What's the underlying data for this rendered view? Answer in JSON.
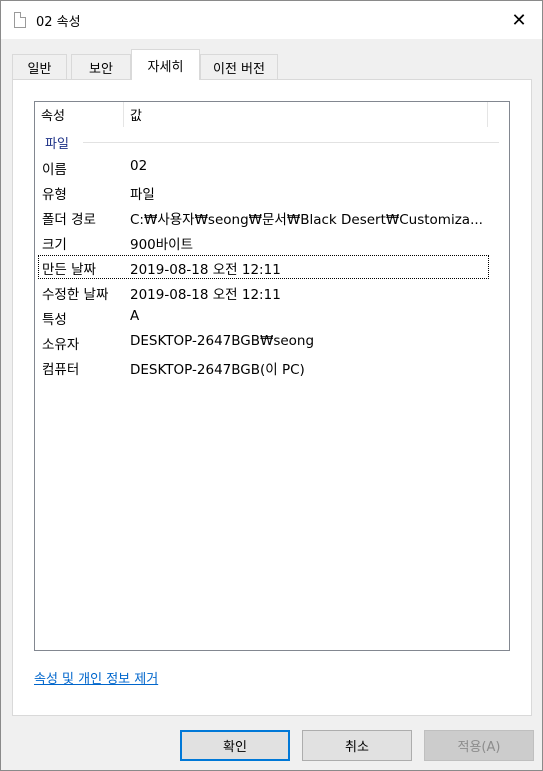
{
  "window": {
    "title": "02 속성",
    "close_label": "✕"
  },
  "tabs": [
    {
      "label": "일반"
    },
    {
      "label": "보안"
    },
    {
      "label": "자세히"
    },
    {
      "label": "이전 버전"
    }
  ],
  "listview": {
    "columns": [
      "속성",
      "값"
    ],
    "group": "파일",
    "rows": [
      {
        "key": "이름",
        "value": "02"
      },
      {
        "key": "유형",
        "value": "파일"
      },
      {
        "key": "폴더 경로",
        "value": "C:₩사용자₩seong₩문서₩Black Desert₩Customiza..."
      },
      {
        "key": "크기",
        "value": "900바이트"
      },
      {
        "key": "만든 날짜",
        "value": "2019-08-18 오전 12:11"
      },
      {
        "key": "수정한 날짜",
        "value": "2019-08-18 오전 12:11"
      },
      {
        "key": "특성",
        "value": "A"
      },
      {
        "key": "소유자",
        "value": "DESKTOP-2647BGB₩seong"
      },
      {
        "key": "컴퓨터",
        "value": "DESKTOP-2647BGB(이 PC)"
      }
    ]
  },
  "remove_link": "속성 및 개인 정보 제거",
  "buttons": {
    "ok": "확인",
    "cancel": "취소",
    "apply": "적용(A)"
  }
}
